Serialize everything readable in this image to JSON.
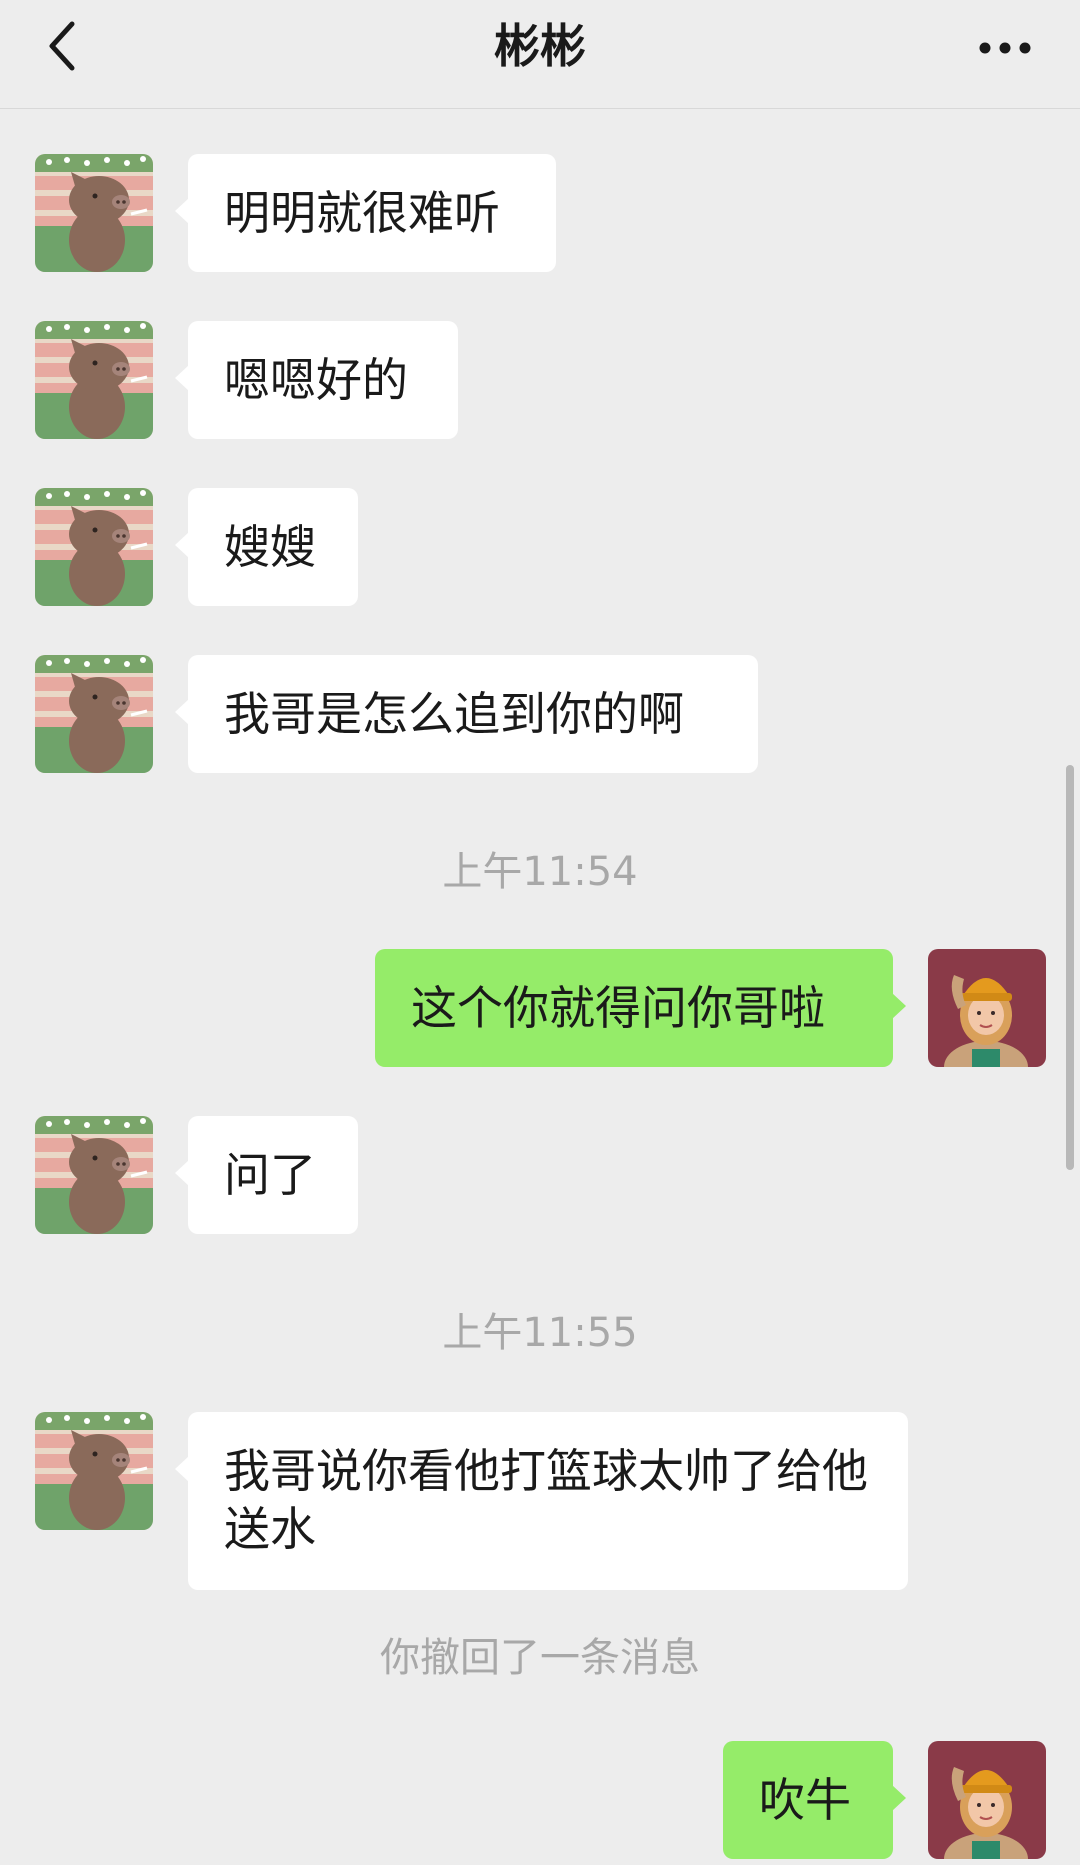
{
  "header": {
    "title": "彬彬",
    "back_icon": "chevron-left-icon",
    "more_icon": "more-dots-icon"
  },
  "colors": {
    "background": "#ededed",
    "incoming_bubble": "#ffffff",
    "outgoing_bubble": "#95ec69",
    "system_text": "#a8a8a8"
  },
  "messages": [
    {
      "sender": "contact",
      "text": "明明就很难听"
    },
    {
      "sender": "contact",
      "text": "嗯嗯好的"
    },
    {
      "sender": "contact",
      "text": "嫂嫂"
    },
    {
      "sender": "contact",
      "text": "我哥是怎么追到你的啊"
    },
    {
      "system": "上午11:54"
    },
    {
      "sender": "me",
      "text": "这个你就得问你哥啦"
    },
    {
      "sender": "contact",
      "text": "问了"
    },
    {
      "system": "上午11:55"
    },
    {
      "sender": "contact",
      "text": "我哥说你看他打篮球太帅了给他送水"
    },
    {
      "system": "你撤回了一条消息"
    },
    {
      "sender": "me",
      "text": "吹牛"
    }
  ]
}
